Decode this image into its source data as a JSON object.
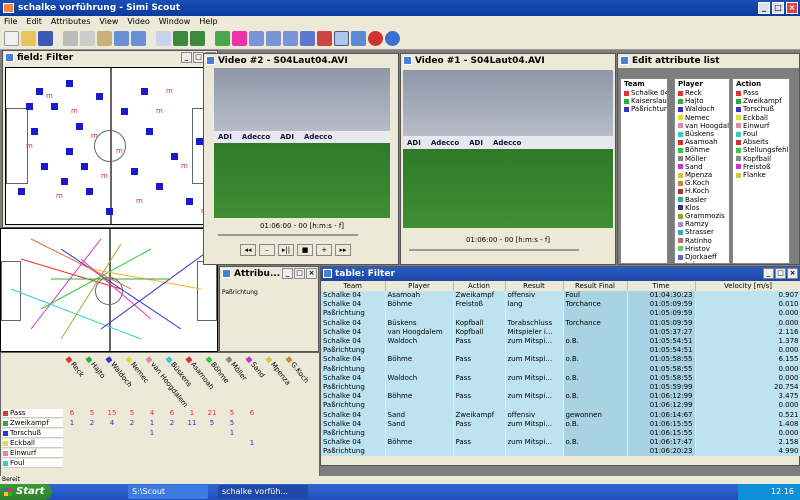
{
  "app": {
    "title": "schalke vorführung - Simi Scout"
  },
  "menu": [
    "File",
    "Edit",
    "Attributes",
    "View",
    "Video",
    "Window",
    "Help"
  ],
  "field_window": {
    "title": "field: Filter"
  },
  "video2": {
    "title": "Video #2 - S04Laut04.AVI",
    "timecode": "01:06:00 - 00 [h:m:s - f]",
    "ads": [
      "ADI",
      "Adecco",
      "ADI",
      "Adecco"
    ]
  },
  "video1": {
    "title": "Video #1 - S04Laut04.AVI",
    "timecode": "01:06:00 - 00 [h:m:s - f]",
    "ads": [
      "ADI",
      "Adecco",
      "ADI",
      "Adecco"
    ]
  },
  "attr_list": {
    "title": "Edit attribute list",
    "team": {
      "header": "Team",
      "items": [
        {
          "label": "Schalke 04",
          "color": "#d33"
        },
        {
          "label": "Kaiserslautern",
          "color": "#3a3"
        },
        {
          "label": "Paßrichtung",
          "color": "#33c"
        }
      ]
    },
    "player": {
      "header": "Player",
      "items": [
        {
          "label": "Reck",
          "color": "#d33"
        },
        {
          "label": "Hajto",
          "color": "#3a3"
        },
        {
          "label": "Waldoch",
          "color": "#33c"
        },
        {
          "label": "Nemec",
          "color": "#dd3"
        },
        {
          "label": "van Hoogdalem",
          "color": "#d8a"
        },
        {
          "label": "Büskens",
          "color": "#3cc"
        },
        {
          "label": "Asamoah",
          "color": "#c33"
        },
        {
          "label": "Böhme",
          "color": "#3c3"
        },
        {
          "label": "Möller",
          "color": "#888"
        },
        {
          "label": "Sand",
          "color": "#c3c"
        },
        {
          "label": "Mpenza",
          "color": "#cc3"
        },
        {
          "label": "G.Koch",
          "color": "#c83"
        },
        {
          "label": "H.Koch",
          "color": "#a33"
        },
        {
          "label": "Basler",
          "color": "#3a8"
        },
        {
          "label": "Klos",
          "color": "#338"
        },
        {
          "label": "Grammozis",
          "color": "#8a3"
        },
        {
          "label": "Ramzy",
          "color": "#a8c"
        },
        {
          "label": "Strasser",
          "color": "#3ac"
        },
        {
          "label": "Ratinho",
          "color": "#c66"
        },
        {
          "label": "Hristov",
          "color": "#6c6"
        },
        {
          "label": "Djorkaeff",
          "color": "#66c"
        },
        {
          "label": "Lokvenc",
          "color": "#cc6"
        }
      ]
    },
    "action": {
      "header": "Action",
      "items": [
        {
          "label": "Pass",
          "color": "#d33"
        },
        {
          "label": "Zweikampf",
          "color": "#3a3"
        },
        {
          "label": "Torschuß",
          "color": "#33c"
        },
        {
          "label": "Eckball",
          "color": "#dd3"
        },
        {
          "label": "Einwurf",
          "color": "#d8a"
        },
        {
          "label": "Foul",
          "color": "#3cc"
        },
        {
          "label": "Abseits",
          "color": "#c33"
        },
        {
          "label": "Stellungsfehl",
          "color": "#3c3"
        },
        {
          "label": "Kopfball",
          "color": "#888"
        },
        {
          "label": "Freistoß",
          "color": "#c3c"
        },
        {
          "label": "Flanke",
          "color": "#cc3"
        }
      ]
    }
  },
  "attribute_window": {
    "title": "Attribu...",
    "label": "Paßrichtung"
  },
  "table": {
    "title": "table: Filter",
    "columns": [
      "Team",
      "Player",
      "Action",
      "Result",
      "Result Final",
      "Time",
      "Velocity [m/s]"
    ],
    "rows": [
      [
        "Schalke 04",
        "Asamoah",
        "Zweikampf",
        "offensiv",
        "Foul",
        "01:04:30:23",
        "0.907"
      ],
      [
        "Schalke 04",
        "Böhme",
        "Freistoß",
        "lang",
        "Torchance",
        "01:05:09:59",
        "0.010"
      ],
      [
        "Paßrichtung",
        "",
        "",
        "",
        "",
        "01:05:09:59",
        "0.000"
      ],
      [
        "Schalke 04",
        "Büskens",
        "Kopfball",
        "Torabschluss",
        "Torchance",
        "01:05:09:59",
        "0.000"
      ],
      [
        "Schalke 04",
        "van Hoogdalem",
        "Kopfball",
        "Mitspieler i...",
        "",
        "01:05:37:27",
        "2.116"
      ],
      [
        "Schalke 04",
        "Waldoch",
        "Pass",
        "zum Mitspi...",
        "o.B.",
        "01:05:54:51",
        "1.378"
      ],
      [
        "Paßrichtung",
        "",
        "",
        "",
        "",
        "01:05:54:51",
        "0.000"
      ],
      [
        "Schalke 04",
        "Böhme",
        "Pass",
        "zum Mitspi...",
        "o.B.",
        "01:05:58:55",
        "6.155"
      ],
      [
        "Paßrichtung",
        "",
        "",
        "",
        "",
        "01:05:58:55",
        "0.000"
      ],
      [
        "Schalke 04",
        "Waldoch",
        "Pass",
        "zum Mitspi...",
        "o.B.",
        "01:05:58:55",
        "0.000"
      ],
      [
        "Paßrichtung",
        "",
        "",
        "",
        "",
        "01:05:59:99",
        "20.754"
      ],
      [
        "Schalke 04",
        "Böhme",
        "Pass",
        "zum Mitspi...",
        "o.B.",
        "01:06:12:99",
        "3.475"
      ],
      [
        "Paßrichtung",
        "",
        "",
        "",
        "",
        "01:06:12:99",
        "0.000"
      ],
      [
        "Schalke 04",
        "Sand",
        "Zweikampf",
        "offensiv",
        "gewonnen",
        "01:06:14:67",
        "0.521"
      ],
      [
        "Schalke 04",
        "Sand",
        "Pass",
        "zum Mitspi...",
        "o.B.",
        "01:06:15:55",
        "1.408"
      ],
      [
        "Paßrichtung",
        "",
        "",
        "",
        "",
        "01:06:15:55",
        "0.000"
      ],
      [
        "Schalke 04",
        "Böhme",
        "Pass",
        "zum Mitspi...",
        "o.B.",
        "01:06:17:47",
        "2.158"
      ],
      [
        "Paßrichtung",
        "",
        "",
        "",
        "",
        "01:06:20:23",
        "4.990"
      ]
    ]
  },
  "matrix": {
    "players": [
      {
        "label": "Reck",
        "color": "#d33"
      },
      {
        "label": "Hajto",
        "color": "#3a3"
      },
      {
        "label": "Waldoch",
        "color": "#33c"
      },
      {
        "label": "Nemec",
        "color": "#dd3"
      },
      {
        "label": "van Hoogdalem",
        "color": "#d8a"
      },
      {
        "label": "Büskens",
        "color": "#3cc"
      },
      {
        "label": "Asamoah",
        "color": "#c33"
      },
      {
        "label": "Böhme",
        "color": "#3c3"
      },
      {
        "label": "Möller",
        "color": "#888"
      },
      {
        "label": "Sand",
        "color": "#c3c"
      },
      {
        "label": "Mpenza",
        "color": "#cc3"
      },
      {
        "label": "G.Koch",
        "color": "#c83"
      }
    ],
    "rows": [
      {
        "label": "Pass",
        "color": "#d33",
        "values": [
          "6",
          "5",
          "15",
          "5",
          "4",
          "6",
          "1",
          "21",
          "5",
          "6",
          "",
          ""
        ],
        "vcolor": "#d33"
      },
      {
        "label": "Zweikampf",
        "color": "#3a3",
        "values": [
          "1",
          "2",
          "4",
          "2",
          "1",
          "2",
          "11",
          "5",
          "5",
          "",
          "",
          ""
        ],
        "vcolor": "#33c"
      },
      {
        "label": "Torschuß",
        "color": "#33c",
        "values": [
          "",
          "",
          "",
          "",
          "1",
          "",
          "",
          "",
          "1",
          "",
          "",
          ""
        ],
        "vcolor": "#33c"
      },
      {
        "label": "Eckball",
        "color": "#dd3",
        "values": [
          "",
          "",
          "",
          "",
          "",
          "",
          "",
          "",
          "",
          "1",
          "",
          ""
        ],
        "vcolor": "#33c"
      },
      {
        "label": "Einwurf",
        "color": "#d8a",
        "values": [
          "",
          "",
          "",
          "",
          "",
          "",
          "",
          "",
          "",
          "",
          "",
          ""
        ],
        "vcolor": "#33c"
      },
      {
        "label": "Foul",
        "color": "#3cc",
        "values": [
          "",
          "",
          "",
          "",
          "",
          "",
          "",
          "",
          "",
          "",
          "",
          ""
        ],
        "vcolor": "#33c"
      }
    ]
  },
  "status": "Bereit",
  "taskbar": {
    "start": "Start",
    "items": [
      "S:\\Scout",
      "schalke vorfüh..."
    ],
    "clock": "12:16"
  }
}
